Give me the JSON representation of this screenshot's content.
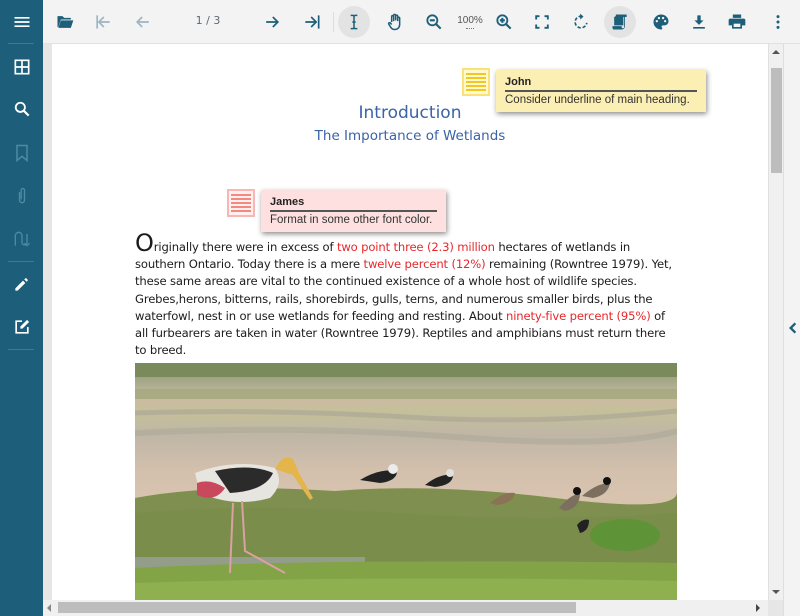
{
  "sidebar": {
    "items": [
      {
        "name": "menu",
        "icon": "hamburger-icon",
        "enabled": true
      },
      {
        "name": "thumbnails",
        "icon": "grid-icon",
        "enabled": true
      },
      {
        "name": "search",
        "icon": "search-icon",
        "enabled": true
      },
      {
        "name": "bookmarks",
        "icon": "bookmark-icon",
        "enabled": false
      },
      {
        "name": "attachments",
        "icon": "paperclip-icon",
        "enabled": false
      },
      {
        "name": "signature",
        "icon": "signature-icon",
        "enabled": false
      },
      {
        "name": "annotate",
        "icon": "pencil-icon",
        "enabled": true
      },
      {
        "name": "edit",
        "icon": "edit-icon",
        "enabled": true
      }
    ],
    "color": "#1d5f7a"
  },
  "toolbar": {
    "open": "folder-open-icon",
    "first_page": "first-page-icon",
    "prev_page": "arrow-left-icon",
    "page_indicator": "1 / 3",
    "next_page": "arrow-right-icon",
    "last_page": "last-page-icon",
    "text_select": "text-cursor-icon",
    "pan": "hand-icon",
    "zoom_out": "zoom-out-icon",
    "zoom_level": "100%",
    "zoom_in": "zoom-in-icon",
    "fit": "fullscreen-icon",
    "rotate": "rotate-icon",
    "read_mode": "scroll-document-icon",
    "theme": "palette-icon",
    "download": "download-icon",
    "print": "print-icon",
    "more": "more-vertical-icon",
    "accent": "#1d5f7a"
  },
  "document": {
    "title": "Introduction",
    "subtitle": "The Importance of Wetlands",
    "paragraph": {
      "dropcap": "O",
      "segments": [
        {
          "text": "riginally there were in excess of ",
          "highlight": false
        },
        {
          "text": "two point three (2.3) million",
          "highlight": true
        },
        {
          "text": " hectares of wetlands in southern Ontario. Today there is a mere ",
          "highlight": false
        },
        {
          "text": "twelve percent (12%)",
          "highlight": true
        },
        {
          "text": " remaining (Rowntree 1979). Yet, these same areas are vital to the continued existence of a whole host of wildlife species. Grebes,herons, bitterns, rails, shorebirds, gulls, terns, and numerous smaller birds, plus the waterfowl, nest in or use wetlands for feeding and resting. About ",
          "highlight": false
        },
        {
          "text": "ninety-five percent (95%)",
          "highlight": true
        },
        {
          "text": " of all furbearers are taken in water (Rowntree 1979). Reptiles and amphibians must return there to breed.",
          "highlight": false
        }
      ]
    },
    "image_alt": "Wetland with painted stork and lapwings",
    "highlight_color": "#e8272b",
    "heading_color": "#3a63a8"
  },
  "comments": [
    {
      "author": "John",
      "text": "Consider underline of main heading.",
      "color": "#fcefb4"
    },
    {
      "author": "James",
      "text": "Format in some other font color.",
      "color": "#fde0df"
    }
  ]
}
